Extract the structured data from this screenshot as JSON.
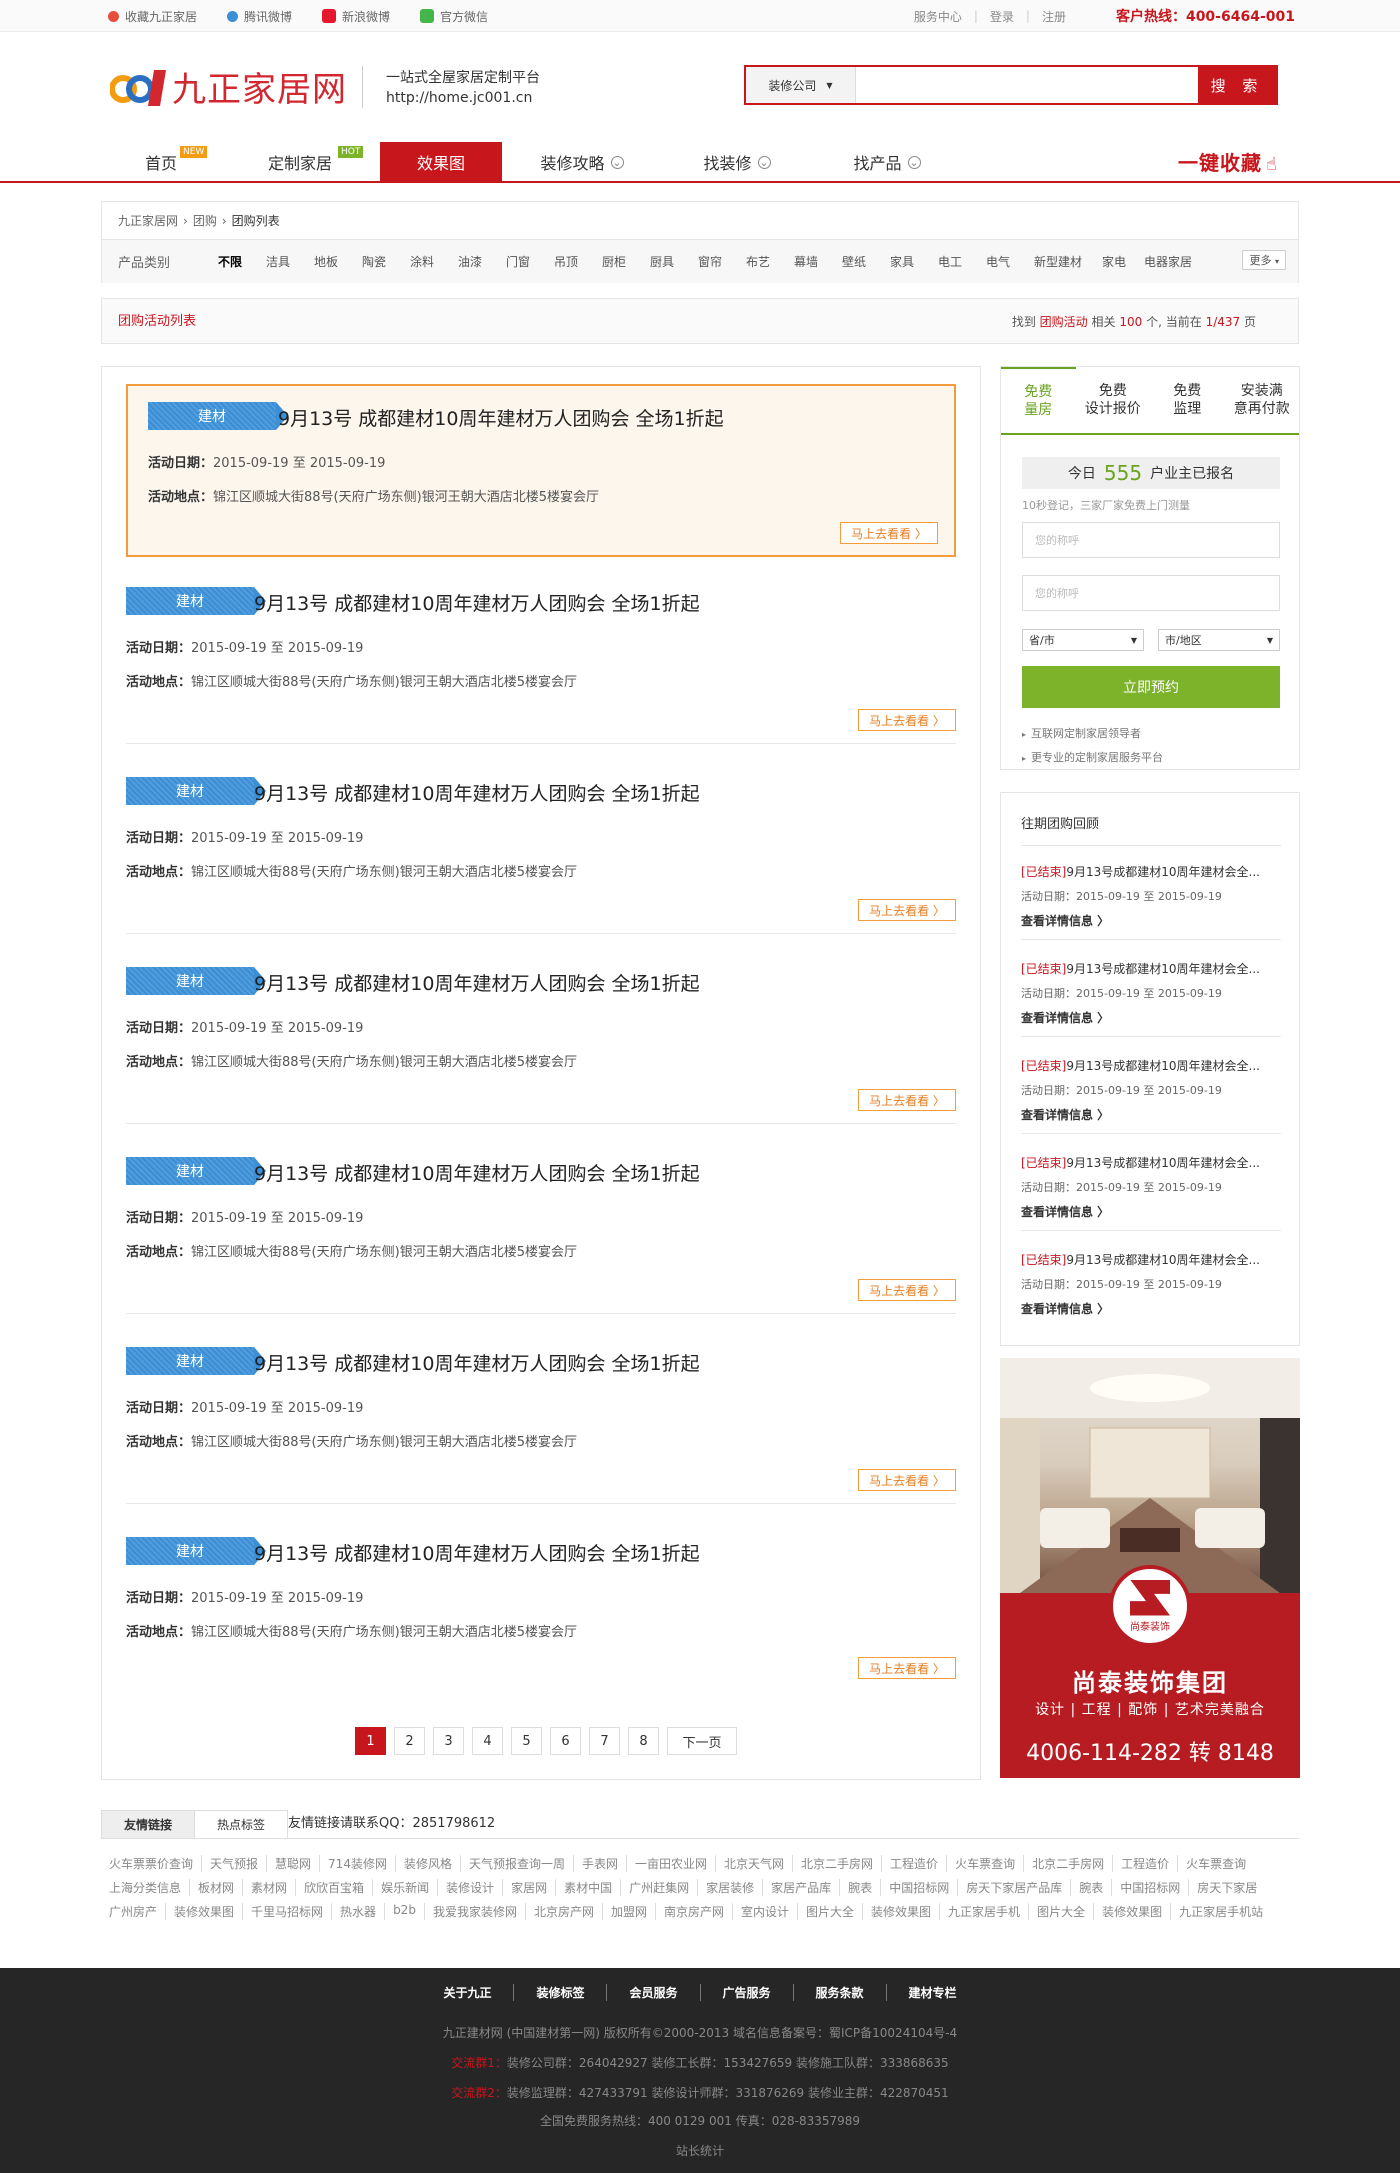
{
  "topbar": {
    "links": [
      "收藏九正家居",
      "腾讯微博",
      "新浪微博",
      "官方微信"
    ],
    "right": [
      "服务中心",
      "登录",
      "注册"
    ],
    "hotline": "客户热线：400-6464-001"
  },
  "header": {
    "logo_text": "九正家居网",
    "slogan1": "一站式全屋家居定制平台",
    "slogan2": "http://home.jc001.cn",
    "search_select": "装修公司",
    "search_btn": "搜 索"
  },
  "nav": {
    "items": [
      {
        "label": "首页",
        "badge": "NEW"
      },
      {
        "label": "定制家居",
        "badge": "HOT"
      },
      {
        "label": "效果图",
        "badge": ""
      },
      {
        "label": "装修攻略",
        "badge": ""
      },
      {
        "label": "找装修",
        "badge": ""
      },
      {
        "label": "找产品",
        "badge": ""
      }
    ],
    "fav": "一键收藏"
  },
  "crumb": [
    "九正家居网",
    "团购",
    "团购列表"
  ],
  "categories": {
    "label": "产品类别",
    "items": [
      "不限",
      "洁具",
      "地板",
      "陶瓷",
      "涂料",
      "油漆",
      "门窗",
      "吊顶",
      "厨柜",
      "厨具",
      "窗帘",
      "布艺",
      "幕墙",
      "壁纸",
      "家具",
      "电工",
      "电气",
      "新型建材",
      "家电",
      "电器家居"
    ],
    "more": "更多"
  },
  "listhead": {
    "title": "团购活动列表",
    "r1": "找到",
    "r2": "团购活动",
    "r3": "相关",
    "count": "100",
    "r4": "个, 当前在",
    "page": "1/437",
    "r5": "页"
  },
  "activities": [
    {
      "tag": "建材",
      "title": "9月13号 成都建材10周年建材万人团购会 全场1折起",
      "date_label": "活动日期：",
      "date": "2015-09-19  至  2015-09-19",
      "place_label": "活动地点：",
      "place": "锦江区顺城大街88号(天府广场东侧)银河王朝大酒店北楼5楼宴会厅",
      "btn": "马上去看看 〉"
    },
    {
      "tag": "建材",
      "title": "9月13号 成都建材10周年建材万人团购会 全场1折起",
      "date_label": "活动日期：",
      "date": "2015-09-19  至  2015-09-19",
      "place_label": "活动地点：",
      "place": "锦江区顺城大街88号(天府广场东侧)银河王朝大酒店北楼5楼宴会厅",
      "btn": "马上去看看 〉"
    },
    {
      "tag": "建材",
      "title": "9月13号 成都建材10周年建材万人团购会 全场1折起",
      "date_label": "活动日期：",
      "date": "2015-09-19  至  2015-09-19",
      "place_label": "活动地点：",
      "place": "锦江区顺城大街88号(天府广场东侧)银河王朝大酒店北楼5楼宴会厅",
      "btn": "马上去看看 〉"
    },
    {
      "tag": "建材",
      "title": "9月13号 成都建材10周年建材万人团购会 全场1折起",
      "date_label": "活动日期：",
      "date": "2015-09-19  至  2015-09-19",
      "place_label": "活动地点：",
      "place": "锦江区顺城大街88号(天府广场东侧)银河王朝大酒店北楼5楼宴会厅",
      "btn": "马上去看看 〉"
    },
    {
      "tag": "建材",
      "title": "9月13号 成都建材10周年建材万人团购会 全场1折起",
      "date_label": "活动日期：",
      "date": "2015-09-19  至  2015-09-19",
      "place_label": "活动地点：",
      "place": "锦江区顺城大街88号(天府广场东侧)银河王朝大酒店北楼5楼宴会厅",
      "btn": "马上去看看 〉"
    },
    {
      "tag": "建材",
      "title": "9月13号 成都建材10周年建材万人团购会 全场1折起",
      "date_label": "活动日期：",
      "date": "2015-09-19  至  2015-09-19",
      "place_label": "活动地点：",
      "place": "锦江区顺城大街88号(天府广场东侧)银河王朝大酒店北楼5楼宴会厅",
      "btn": "马上去看看 〉"
    },
    {
      "tag": "建材",
      "title": "9月13号 成都建材10周年建材万人团购会 全场1折起",
      "date_label": "活动日期：",
      "date": "2015-09-19  至  2015-09-19",
      "place_label": "活动地点：",
      "place": "锦江区顺城大街88号(天府广场东侧)银河王朝大酒店北楼5楼宴会厅",
      "btn": "马上去看看 〉"
    }
  ],
  "pager": {
    "pages": [
      "1",
      "2",
      "3",
      "4",
      "5",
      "6",
      "7",
      "8"
    ],
    "current": "1",
    "next": "下一页"
  },
  "form": {
    "tabs": [
      {
        "l1": "免费",
        "l2": "量房"
      },
      {
        "l1": "免费",
        "l2": "设计报价"
      },
      {
        "l1": "免费",
        "l2": "监理"
      },
      {
        "l1": "安装满",
        "l2": "意再付款"
      }
    ],
    "today_pre": "今日",
    "today_num": "555",
    "today_post": "户业主已报名",
    "tip": "10秒登记，三家厂家免费上门测量",
    "name_ph": "您的称呼",
    "phone_ph": "您的称呼",
    "province": "省/市",
    "city": "市/地区",
    "submit": "立即预约",
    "note1": "互联网定制家居领导者",
    "note2": "更专业的定制家居服务平台"
  },
  "past": {
    "title": "往期团购回顾",
    "items": [
      {
        "status": "[已结束]",
        "title": "9月13号成都建材10周年建材会全...",
        "date_label": "活动日期：",
        "date": "2015-09-19  至  2015-09-19",
        "more": "查看详情信息 〉"
      },
      {
        "status": "[已结束]",
        "title": "9月13号成都建材10周年建材会全...",
        "date_label": "活动日期：",
        "date": "2015-09-19  至  2015-09-19",
        "more": "查看详情信息 〉"
      },
      {
        "status": "[已结束]",
        "title": "9月13号成都建材10周年建材会全...",
        "date_label": "活动日期：",
        "date": "2015-09-19  至  2015-09-19",
        "more": "查看详情信息 〉"
      },
      {
        "status": "[已结束]",
        "title": "9月13号成都建材10周年建材会全...",
        "date_label": "活动日期：",
        "date": "2015-09-19  至  2015-09-19",
        "more": "查看详情信息 〉"
      },
      {
        "status": "[已结束]",
        "title": "9月13号成都建材10周年建材会全...",
        "date_label": "活动日期：",
        "date": "2015-09-19  至  2015-09-19",
        "more": "查看详情信息 〉"
      }
    ]
  },
  "ad": {
    "brand": "尚泰装饰",
    "name": "尚泰装饰集团",
    "slogan": "设计 | 工程 | 配饰 | 艺术完美融合",
    "phone": "4006-114-282 转 8148"
  },
  "links": {
    "tabs": [
      "友情链接",
      "热点标签"
    ],
    "contact": "友情链接请联系QQ：2851798612",
    "row1": [
      "火车票票价查询",
      "天气预报",
      "慧聪网",
      "714装修网",
      "装修风格",
      "天气预报查询一周",
      "手表网",
      "一亩田农业网",
      "北京天气网",
      "北京二手房网",
      "工程造价",
      "火车票查询",
      "北京二手房网",
      "工程造价",
      "火车票查询"
    ],
    "row2": [
      "上海分类信息",
      "板材网",
      "素材网",
      "欣欣百宝箱",
      "娱乐新闻",
      "装修设计",
      "家居网",
      "素材中国",
      "广州赶集网",
      "家居装修",
      "家居产品库",
      "腕表",
      "中国招标网",
      "房天下家居产品库",
      "腕表",
      "中国招标网",
      "房天下家居"
    ],
    "row3": [
      "广州房产",
      "装修效果图",
      "千里马招标网",
      "热水器",
      "b2b",
      "我爱我家装修网",
      "北京房产网",
      "加盟网",
      "南京房产网",
      "室内设计",
      "图片大全",
      "装修效果图",
      "九正家居手机",
      "图片大全",
      "装修效果图",
      "九正家居手机站"
    ]
  },
  "footer": {
    "nav": [
      "关于九正",
      "装修标签",
      "会员服务",
      "广告服务",
      "服务条款",
      "建材专栏"
    ],
    "copyright": "九正建材网 (中国建材第一网) 版权所有©2000-2013   域名信息备案号：蜀ICP备10024104号-4",
    "qq1_label": "交流群1：",
    "qq1": "装修公司群：264042927   装修工长群：153427659   装修施工队群：333868635",
    "qq2_label": "交流群2：",
    "qq2": "装修监理群：427433791   装修设计师群：331876269   装修业主群：422870451",
    "service": "全国免费服务热线：400 0129 001  传真：028-83357989",
    "stat": "站长统计"
  },
  "colors": {
    "brand_red": "#c8161d",
    "accent_orange": "#f39c3d",
    "tag_blue": "#3a8fd6",
    "form_green": "#7cb32a"
  }
}
